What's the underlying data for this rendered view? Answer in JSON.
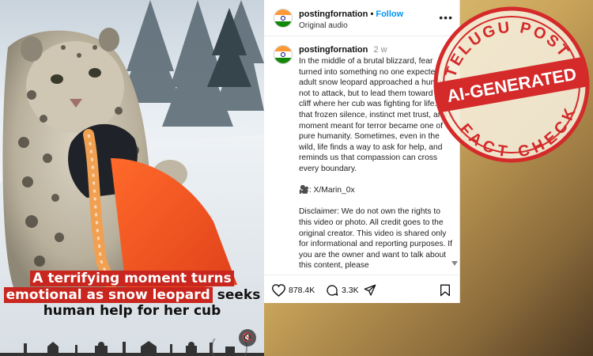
{
  "video": {
    "caption_lines": [
      {
        "highlight": "A terrifying moment turns",
        "rest": ""
      },
      {
        "highlight": "emotional as snow leopard",
        "rest": " seeks"
      },
      {
        "highlight": "",
        "rest": "human help for her cub"
      }
    ],
    "mute_icon": "speaker-muted-icon"
  },
  "post": {
    "username": "postingfornation",
    "follow_label": "Follow",
    "audio_label": "Original audio",
    "comment": {
      "username": "postingfornation",
      "age": "2 w",
      "paragraphs": [
        "In the middle of a brutal blizzard, fear turned into something no one expected. An adult snow leopard approached a human, not to attack, but to lead them toward a cliff where her cub was fighting for life. In that frozen silence, instinct met trust, and a moment meant for terror became one of pure humanity. Sometimes, even in the wild, life finds a way to ask for help, and reminds us that compassion can cross every boundary.",
        "🎥: X/Marin_0x",
        "Disclaimer: We do not own the rights to this video or photo. All credit goes to the original creator. This video is shared only for informational and reporting purposes. If you are the owner and want to talk about this content, please"
      ]
    },
    "likes": "878.4K",
    "comments": "3.3K"
  },
  "stamp": {
    "top_text": "TELUGU POST",
    "middle_text": "AI-GENERATED",
    "bottom_text": "FACT CHECK",
    "color": "#d42a2a"
  },
  "colors": {
    "highlight_red": "#c8261e",
    "follow_blue": "#0095f6"
  }
}
